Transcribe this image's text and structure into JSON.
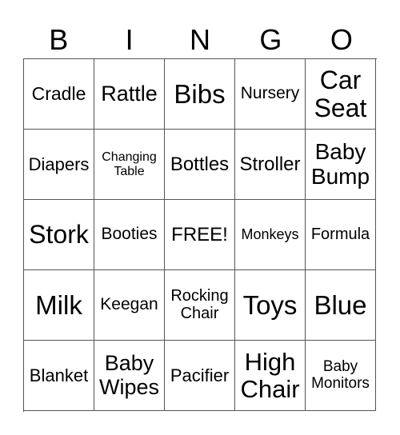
{
  "header": [
    "B",
    "I",
    "N",
    "G",
    "O"
  ],
  "cells": [
    {
      "text": "Cradle",
      "size": 23
    },
    {
      "text": "Rattle",
      "size": 27
    },
    {
      "text": "Bibs",
      "size": 33
    },
    {
      "text": "Nursery",
      "size": 21
    },
    {
      "text": "Car\nSeat",
      "size": 32
    },
    {
      "text": "Diapers",
      "size": 22
    },
    {
      "text": "Changing\nTable",
      "size": 16
    },
    {
      "text": "Bottles",
      "size": 24
    },
    {
      "text": "Stroller",
      "size": 24
    },
    {
      "text": "Baby\nBump",
      "size": 28
    },
    {
      "text": "Stork",
      "size": 32
    },
    {
      "text": "Booties",
      "size": 21
    },
    {
      "text": "FREE!",
      "size": 24
    },
    {
      "text": "Monkeys",
      "size": 18
    },
    {
      "text": "Formula",
      "size": 20
    },
    {
      "text": "Milk",
      "size": 33
    },
    {
      "text": "Keegan",
      "size": 21
    },
    {
      "text": "Rocking\nChair",
      "size": 20
    },
    {
      "text": "Toys",
      "size": 33
    },
    {
      "text": "Blue",
      "size": 33
    },
    {
      "text": "Blanket",
      "size": 22
    },
    {
      "text": "Baby\nWipes",
      "size": 27
    },
    {
      "text": "Pacifier",
      "size": 22
    },
    {
      "text": "High\nChair",
      "size": 31
    },
    {
      "text": "Baby\nMonitors",
      "size": 19
    }
  ]
}
